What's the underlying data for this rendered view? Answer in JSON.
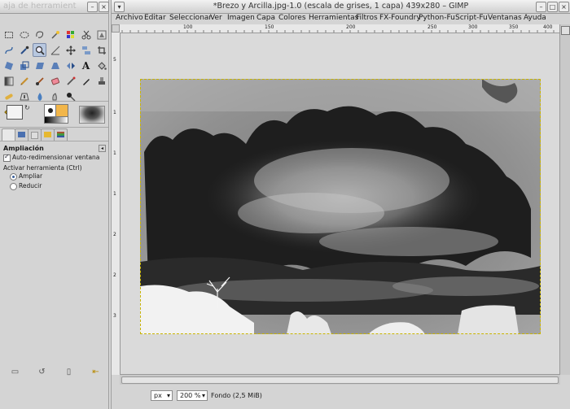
{
  "toolbox": {
    "title": "aja de herramient",
    "options_title": "Ampliación",
    "auto_resize": "Auto-redimensionar ventana",
    "toggle_label": "Activar herramienta  (Ctrl)",
    "radio_in": "Ampliar",
    "radio_out": "Reducir"
  },
  "image_window": {
    "title": "*Brezo y Arcilla.jpg-1.0 (escala de grises, 1 capa) 439x280 – GIMP",
    "menu": [
      "Archivo",
      "Editar",
      "Seleccionar",
      "Ver",
      "Imagen",
      "Capa",
      "Colores",
      "Herramientas",
      "Filtros",
      "FX-Foundry",
      "Python-Fu",
      "Script-Fu",
      "Ventanas",
      "Ayuda"
    ],
    "ruler_h_ticks": [
      "100",
      "150",
      "200",
      "250",
      "300",
      "350",
      "400"
    ],
    "ruler_v_ticks": [
      "5",
      "1",
      "1",
      "1",
      "2",
      "2",
      "3"
    ],
    "status": {
      "unit": "px",
      "zoom": "200 %",
      "layer_info": "Fondo (2,5 MiB)"
    }
  },
  "colors": {
    "selection": "#b8c8e0",
    "canvas_bg": "#dadada"
  }
}
